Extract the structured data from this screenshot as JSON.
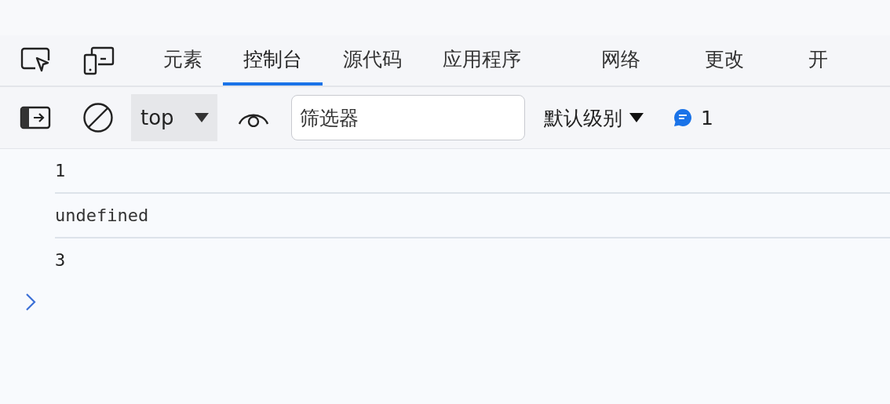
{
  "tabs": [
    {
      "label": "元素",
      "selected": false
    },
    {
      "label": "控制台",
      "selected": true
    },
    {
      "label": "源代码",
      "selected": false
    },
    {
      "label": "应用程序",
      "selected": false
    },
    {
      "label": "网络",
      "selected": false
    },
    {
      "label": "更改",
      "selected": false
    },
    {
      "label": "开",
      "selected": false
    }
  ],
  "toolbar": {
    "context": "top",
    "filter": {
      "placeholder": "筛选器"
    },
    "levels": "默认级别",
    "message_count": "1"
  },
  "console": {
    "lines": [
      {
        "text": "1",
        "kind": "number"
      },
      {
        "text": "undefined",
        "kind": "undefined"
      },
      {
        "text": "3",
        "kind": "number"
      }
    ]
  }
}
